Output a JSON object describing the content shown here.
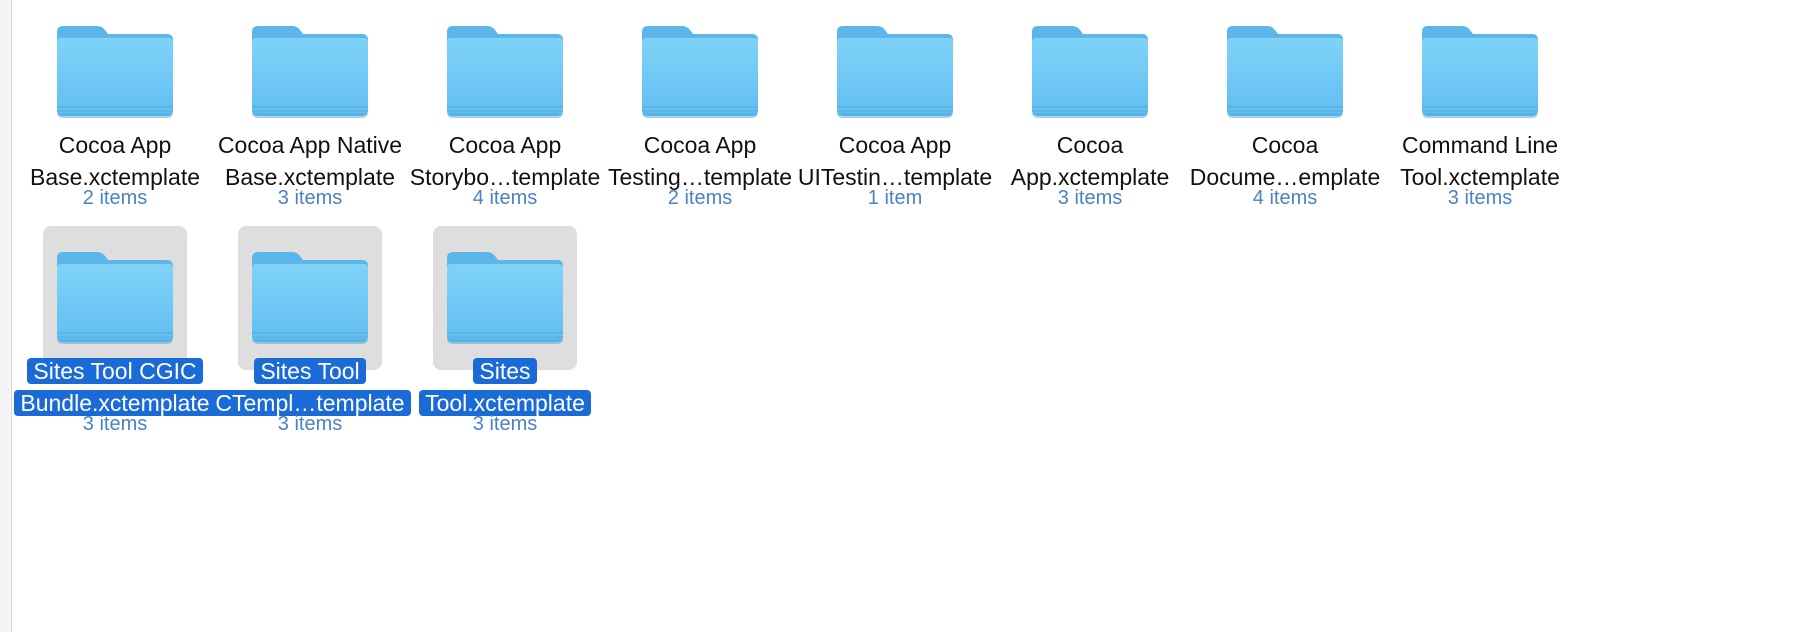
{
  "window": {
    "folders": [
      {
        "line1": "Cocoa App",
        "line2": "Base.xctemplate",
        "count": "2 items",
        "selected": false
      },
      {
        "line1": "Cocoa App Native",
        "line2": "Base.xctemplate",
        "count": "3 items",
        "selected": false
      },
      {
        "line1": "Cocoa App",
        "line2": "Storybo…template",
        "count": "4 items",
        "selected": false
      },
      {
        "line1": "Cocoa App",
        "line2": "Testing…template",
        "count": "2 items",
        "selected": false
      },
      {
        "line1": "Cocoa App",
        "line2": "UITestin…template",
        "count": "1 item",
        "selected": false
      },
      {
        "line1": "Cocoa",
        "line2": "App.xctemplate",
        "count": "3 items",
        "selected": false
      },
      {
        "line1": "Cocoa",
        "line2": "Docume…emplate",
        "count": "4 items",
        "selected": false
      },
      {
        "line1": "Command Line",
        "line2": "Tool.xctemplate",
        "count": "3 items",
        "selected": false
      },
      {
        "line1": "Sites Tool CGIC",
        "line2": "Bundle.xctemplate",
        "count": "3 items",
        "selected": true
      },
      {
        "line1": "Sites Tool",
        "line2": "CTempl…template",
        "count": "3 items",
        "selected": true
      },
      {
        "line1": "Sites",
        "line2": "Tool.xctemplate",
        "count": "3 items",
        "selected": true
      }
    ],
    "icon": "folder-icon",
    "colors": {
      "selection": "#1a6ad7",
      "item_count": "#4a82c6",
      "thumb_selected": "#dedede",
      "folder_top": "#72c8f4",
      "folder_body": "#6cc6f5"
    }
  }
}
